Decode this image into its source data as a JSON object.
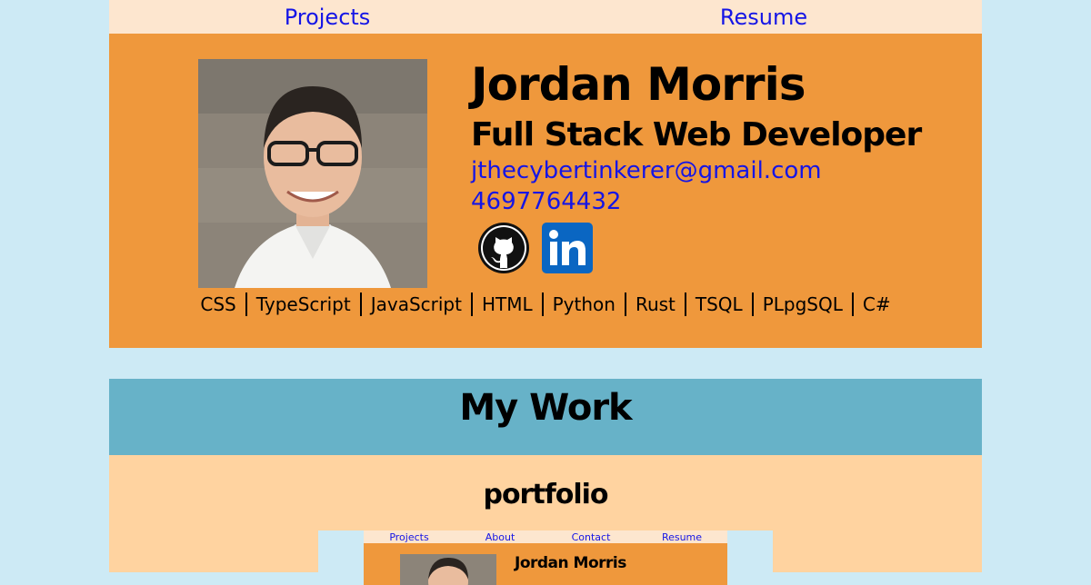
{
  "nav": {
    "projects": "Projects",
    "resume": "Resume"
  },
  "profile": {
    "name": "Jordan Morris",
    "role": "Full Stack Web Developer",
    "email": "jthecybertinkerer@gmail.com",
    "phone": "4697764432",
    "skills": [
      "CSS",
      "TypeScript",
      "JavaScript",
      "HTML",
      "Python",
      "Rust",
      "TSQL",
      "PLpgSQL",
      "C#"
    ]
  },
  "work": {
    "heading": "My Work"
  },
  "project": {
    "title": "portfolio",
    "preview": {
      "nav": [
        "Projects",
        "About",
        "Contact",
        "Resume"
      ],
      "name": "Jordan Morris"
    }
  },
  "colors": {
    "page_bg": "#cdeaf5",
    "nav_bg": "#fde6cf",
    "header_bg": "#ef983c",
    "work_bg": "#67b2c8",
    "project_bg": "#ffd3a0",
    "link": "#1515e6"
  }
}
